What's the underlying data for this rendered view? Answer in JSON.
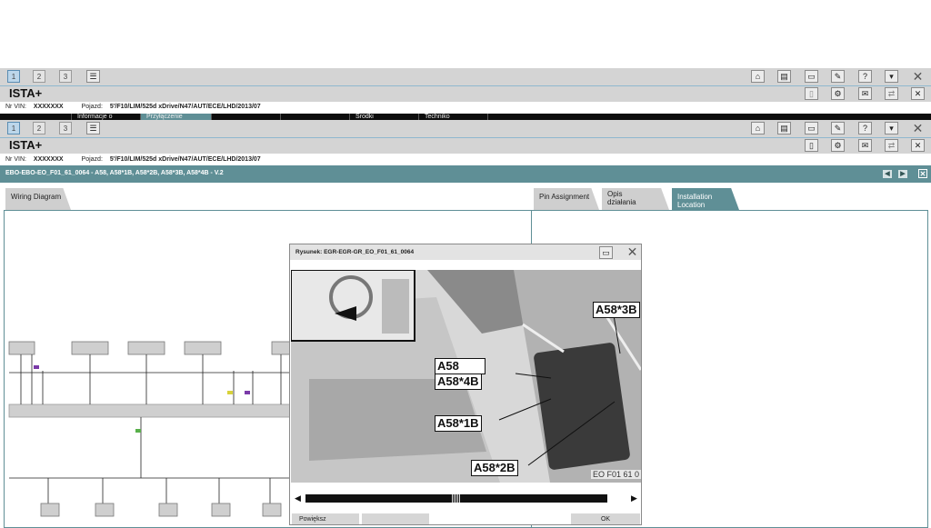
{
  "window_back": {
    "tabs": [
      "1",
      "2",
      "3"
    ],
    "app_title": "ISTA+",
    "vin_label": "Nr VIN:",
    "vin_value": "XXXXXXX",
    "vehicle_label": "Pojazd:",
    "vehicle_value": "5'/F10/LIM/525d xDrive/N47/AUT/ECE/LHD/2013/07",
    "menu": [
      "Informacje o",
      "Przyłączenie",
      "",
      "",
      "Środki",
      "Techniko",
      ""
    ]
  },
  "window_front": {
    "tabs": [
      "1",
      "2",
      "3"
    ],
    "app_title": "ISTA+",
    "vin_label": "Nr VIN:",
    "vin_value": "XXXXXXX",
    "vehicle_label": "Pojazd:",
    "vehicle_value": "5'/F10/LIM/525d xDrive/N47/AUT/ECE/LHD/2013/07"
  },
  "document": {
    "title": "EBO-EBO-EO_F01_61_0064 - A58, A58*1B, A58*2B, A58*3B, A58*4B - V.2",
    "left_tab": "Wiring Diagram",
    "right_tabs": [
      "Pin Assignment",
      "Opis działania",
      "Installation Location"
    ],
    "active_right_tab": 2
  },
  "dialog": {
    "title": "Rysunek: EGR-EGR-GR_EO_F01_61_0064",
    "callouts": [
      "A58*3B",
      "A58",
      "A58*4B",
      "A58*1B",
      "A58*2B"
    ],
    "figure_code": "EO F01 61 0",
    "buttons": [
      "Powiększ",
      "",
      "OK"
    ]
  },
  "icons": {
    "toolbar": [
      "home-icon",
      "overview-icon",
      "print-icon",
      "wrench-icon",
      "help-icon",
      "dropdown-icon",
      "close-icon"
    ],
    "toolbar2": [
      "document-icon",
      "gear-icon",
      "mail-icon",
      "transfer-icon",
      "close-icon"
    ]
  },
  "colors": {
    "accent_teal": "#5f8f96",
    "toolbar_gray": "#d4d4d4",
    "selection_blue": "#bcd6ea"
  }
}
